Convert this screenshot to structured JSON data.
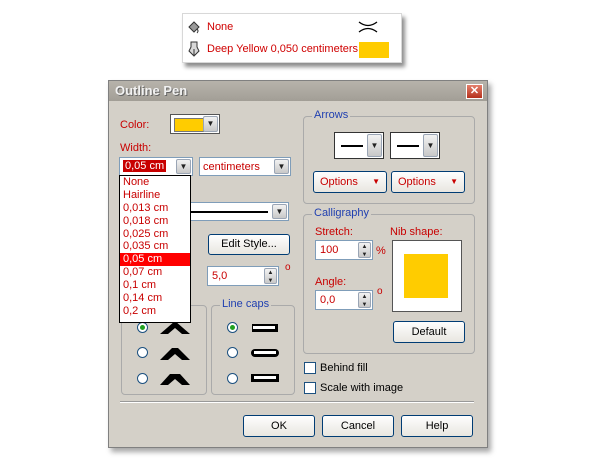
{
  "status_panel": {
    "outline_none_label": "None",
    "outline_current_label": "Deep Yellow  0,050 centimeters",
    "fill_color": "#ffcc00"
  },
  "dialog": {
    "title": "Outline Pen",
    "color_label": "Color:",
    "color_value": "#ffcc00",
    "width_label": "Width:",
    "width_value": "0,05 cm",
    "units_value": "centimeters",
    "width_options": [
      "None",
      "Hairline",
      "0,013 cm",
      "0,018 cm",
      "0,025 cm",
      "0,035 cm",
      "0,05 cm",
      "0,07 cm",
      "0,1 cm",
      "0,14 cm",
      "0,2 cm"
    ],
    "width_selected_index": 6,
    "edit_style_label": "Edit Style...",
    "miter_limit_value": "5,0",
    "degree_symbol": "o",
    "line_caps_label": "Line caps",
    "arrows": {
      "label": "Arrows",
      "options_left": "Options",
      "options_right": "Options"
    },
    "calligraphy": {
      "label": "Calligraphy",
      "stretch_label": "Stretch:",
      "stretch_value": "100",
      "percent": "%",
      "angle_label": "Angle:",
      "angle_value": "0,0",
      "nib_label": "Nib shape:",
      "default_label": "Default",
      "nib_color": "#ffcc00"
    },
    "behind_fill_label": "Behind fill",
    "scale_with_image_label": "Scale with image",
    "ok_label": "OK",
    "cancel_label": "Cancel",
    "help_label": "Help"
  }
}
